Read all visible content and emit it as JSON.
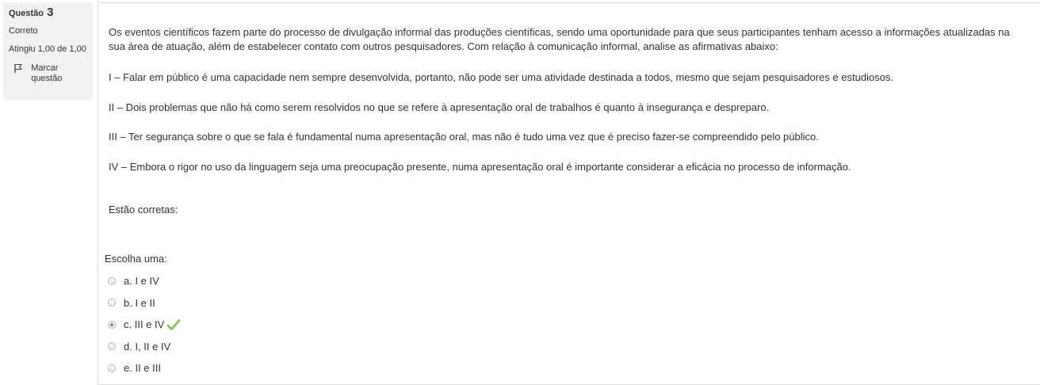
{
  "info": {
    "question_label": "Questão",
    "question_number": "3",
    "state": "Correto",
    "grade": "Atingiu 1,00 de 1,00",
    "flag_label": "Marcar questão"
  },
  "question": {
    "intro": "Os eventos científicos fazem parte do processo de divulgação informal das produções científicas, sendo uma oportunidade para que seus participantes tenham acesso a informações atualizadas na sua área de atuação, além de estabelecer contato com outros pesquisadores. Com relação à comunicação informal, analise as afirmativas abaixo:",
    "statements": [
      "I – Falar em público é uma capacidade nem sempre desenvolvida, portanto, não pode ser uma atividade destinada a todos, mesmo que sejam pesquisadores e estudiosos.",
      "II – Dois problemas que não há como serem resolvidos no que se refere à apresentação oral de trabalhos é quanto à insegurança e despreparo.",
      "III – Ter segurança sobre o que se fala é fundamental numa apresentação oral, mas não é tudo uma vez que é preciso fazer-se compreendido pelo público.",
      "IV – Embora o rigor no uso da linguagem seja uma preocupação presente, numa apresentação oral é importante considerar a eficácia no processo de informação."
    ],
    "closing": "Estão corretas:"
  },
  "answer": {
    "prompt": "Escolha uma:",
    "options": [
      {
        "label": "a. I e IV",
        "selected": false
      },
      {
        "label": "b. I e II",
        "selected": false
      },
      {
        "label": "c. III e IV",
        "selected": true,
        "correct": true
      },
      {
        "label": "d. I, II e IV",
        "selected": false
      },
      {
        "label": "e. II e III",
        "selected": false
      }
    ]
  },
  "colors": {
    "check": "#7ac143",
    "info_bg": "#f1f1f1",
    "text": "#333333"
  }
}
